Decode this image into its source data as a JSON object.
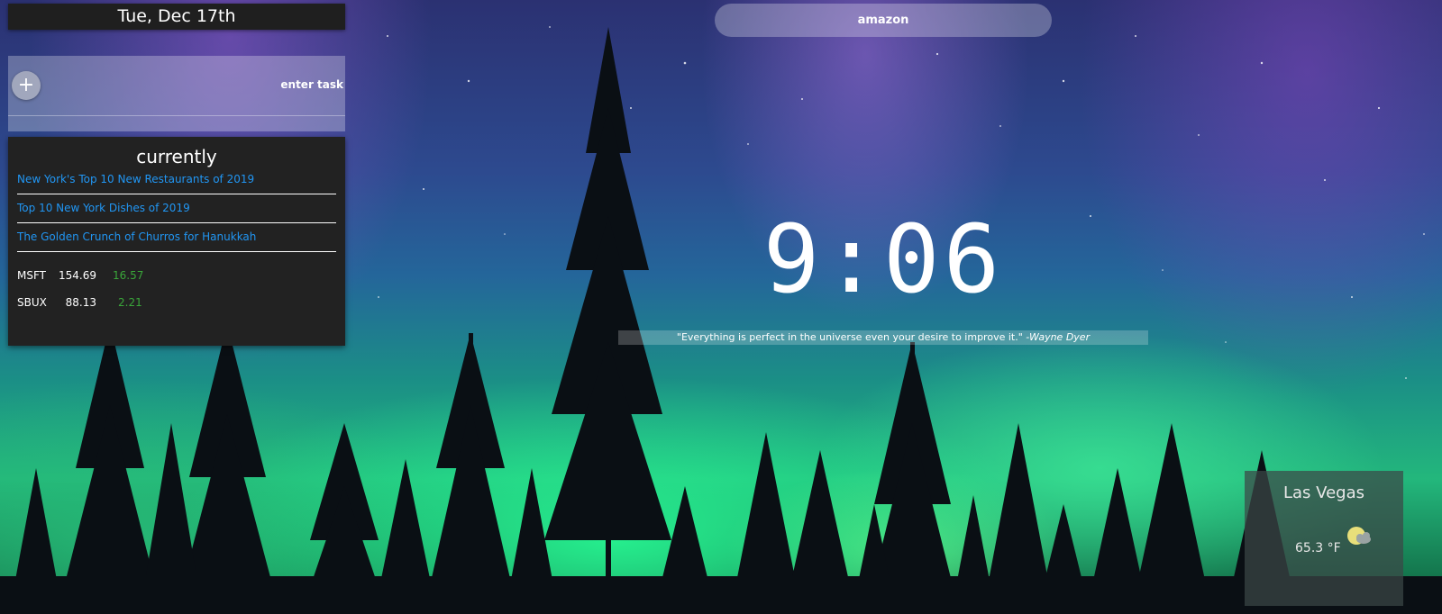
{
  "date": {
    "label": "Tue, Dec 17th"
  },
  "search": {
    "value": "amazon"
  },
  "tasks": {
    "add_label": "+",
    "placeholder": "enter task"
  },
  "currently": {
    "title": "currently",
    "news": [
      {
        "title": "New York's Top 10 New Restaurants of 2019"
      },
      {
        "title": "Top 10 New York Dishes of 2019"
      },
      {
        "title": "The Golden Crunch of Churros for Hanukkah"
      }
    ],
    "stocks": [
      {
        "symbol": "MSFT",
        "price": "154.69",
        "change": "16.57"
      },
      {
        "symbol": "SBUX",
        "price": "88.13",
        "change": "2.21"
      }
    ]
  },
  "clock": {
    "time": "9:06"
  },
  "quote": {
    "text": "\"Everything is perfect in the universe even your desire to improve it.\"",
    "author": " -Wayne Dyer"
  },
  "weather": {
    "city": "Las Vegas",
    "temperature": "65.3 °F",
    "icon": "partly-cloudy-icon"
  },
  "colors": {
    "panel": "#222222",
    "link": "#2196f3",
    "stock_up": "#3aa63a"
  }
}
